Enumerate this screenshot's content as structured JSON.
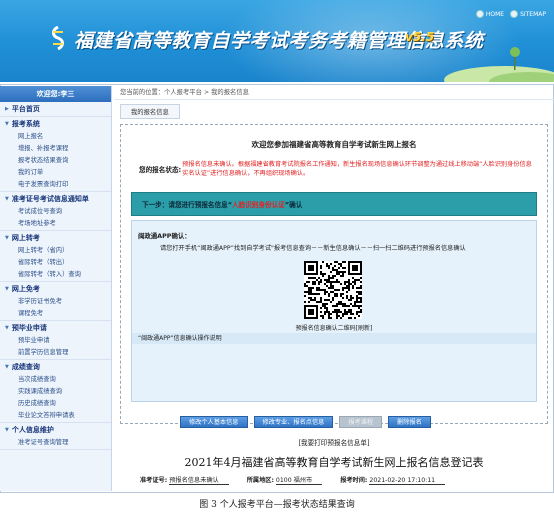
{
  "header": {
    "title": "福建省高等教育自学考试考务考籍管理信息系统",
    "version": "v5.5",
    "home_label": "HOME",
    "sitemap_label": "SITEMAP",
    "logo_icon": "ribbon-logo-icon"
  },
  "sidebar": {
    "welcome": "欢迎您:李三",
    "groups": [
      {
        "title": "平台首页",
        "expanded": false,
        "items": []
      },
      {
        "title": "报考系统",
        "expanded": true,
        "items": [
          "网上报名",
          "增报、补报考课程",
          "报考状态结果查询",
          "我的订单",
          "电子发票查询打印"
        ]
      },
      {
        "title": "准考证号考试信息通知单",
        "expanded": true,
        "items": [
          "考试成位号查询",
          "考场地址参考"
        ]
      },
      {
        "title": "网上转考",
        "expanded": true,
        "items": [
          "网上转考（省内）",
          "省际转考（转出）",
          "省际转考（转入）查询"
        ]
      },
      {
        "title": "网上免考",
        "expanded": true,
        "items": [
          "非学历证书免考",
          "课程免考"
        ]
      },
      {
        "title": "预毕业申请",
        "expanded": true,
        "items": [
          "预毕业申请",
          "前置学历信息管理"
        ]
      },
      {
        "title": "成绩查询",
        "expanded": true,
        "items": [
          "当次成绩查询",
          "实践课成绩查询",
          "历史成绩查询",
          "毕业论文答辩申请表"
        ]
      },
      {
        "title": "个人信息维护",
        "expanded": true,
        "items": [
          "准考证号查询管理"
        ]
      }
    ]
  },
  "main": {
    "breadcrumb": "您当前的位置：个人报考平台 > 我的报名信息",
    "tab": "我的报名信息",
    "heading": "欢迎您参加福建省高等教育自学考试新生网上报名",
    "status_label": "您的报名状态:",
    "status_text": "预报名信息未确认。根据福建省教育考试院报名工作通知，新生报名现场信息确认环节调整为通过线上移动端“人脸识别身份信息实名认证”进行信息确认，不再组织现场确认。",
    "next_step_prefix": "下一步：请您进行预报名信息“",
    "next_step_highlight": "人脸识别身份认证",
    "next_step_suffix": "”确认",
    "app_title": "闽政通APP确认：",
    "app_instruction": "请您打开手机“闽政通APP”找到自学考试\"报考信息查询－－新生信息确认－－扫一扫二维码进行预报名信息确认",
    "qr_caption": "预报名信息确认二维码[刷新]",
    "note_bar": "“闽政通APP”信息确认操作说明",
    "buttons": [
      {
        "label": "修改个人基本信息",
        "disabled": false
      },
      {
        "label": "修改专业、报名点信息",
        "disabled": false
      },
      {
        "label": "报考课程",
        "disabled": true
      },
      {
        "label": "删除报名",
        "disabled": false
      }
    ],
    "print_link": "[我要打印预报名信息单]",
    "register_title": "2021年4月福建省高等教育自学考试新生网上报名信息登记表",
    "register": {
      "exam_no_label": "准考证号:",
      "exam_no_value": "预报名信息未确认",
      "region_label": "所属地区:",
      "region_value": "0100 福州市",
      "time_label": "报考时间:",
      "time_value": "2021-02-20 17:10:11"
    }
  },
  "figure_caption": "图 3 个人报考平台—报考状态结果查询"
}
